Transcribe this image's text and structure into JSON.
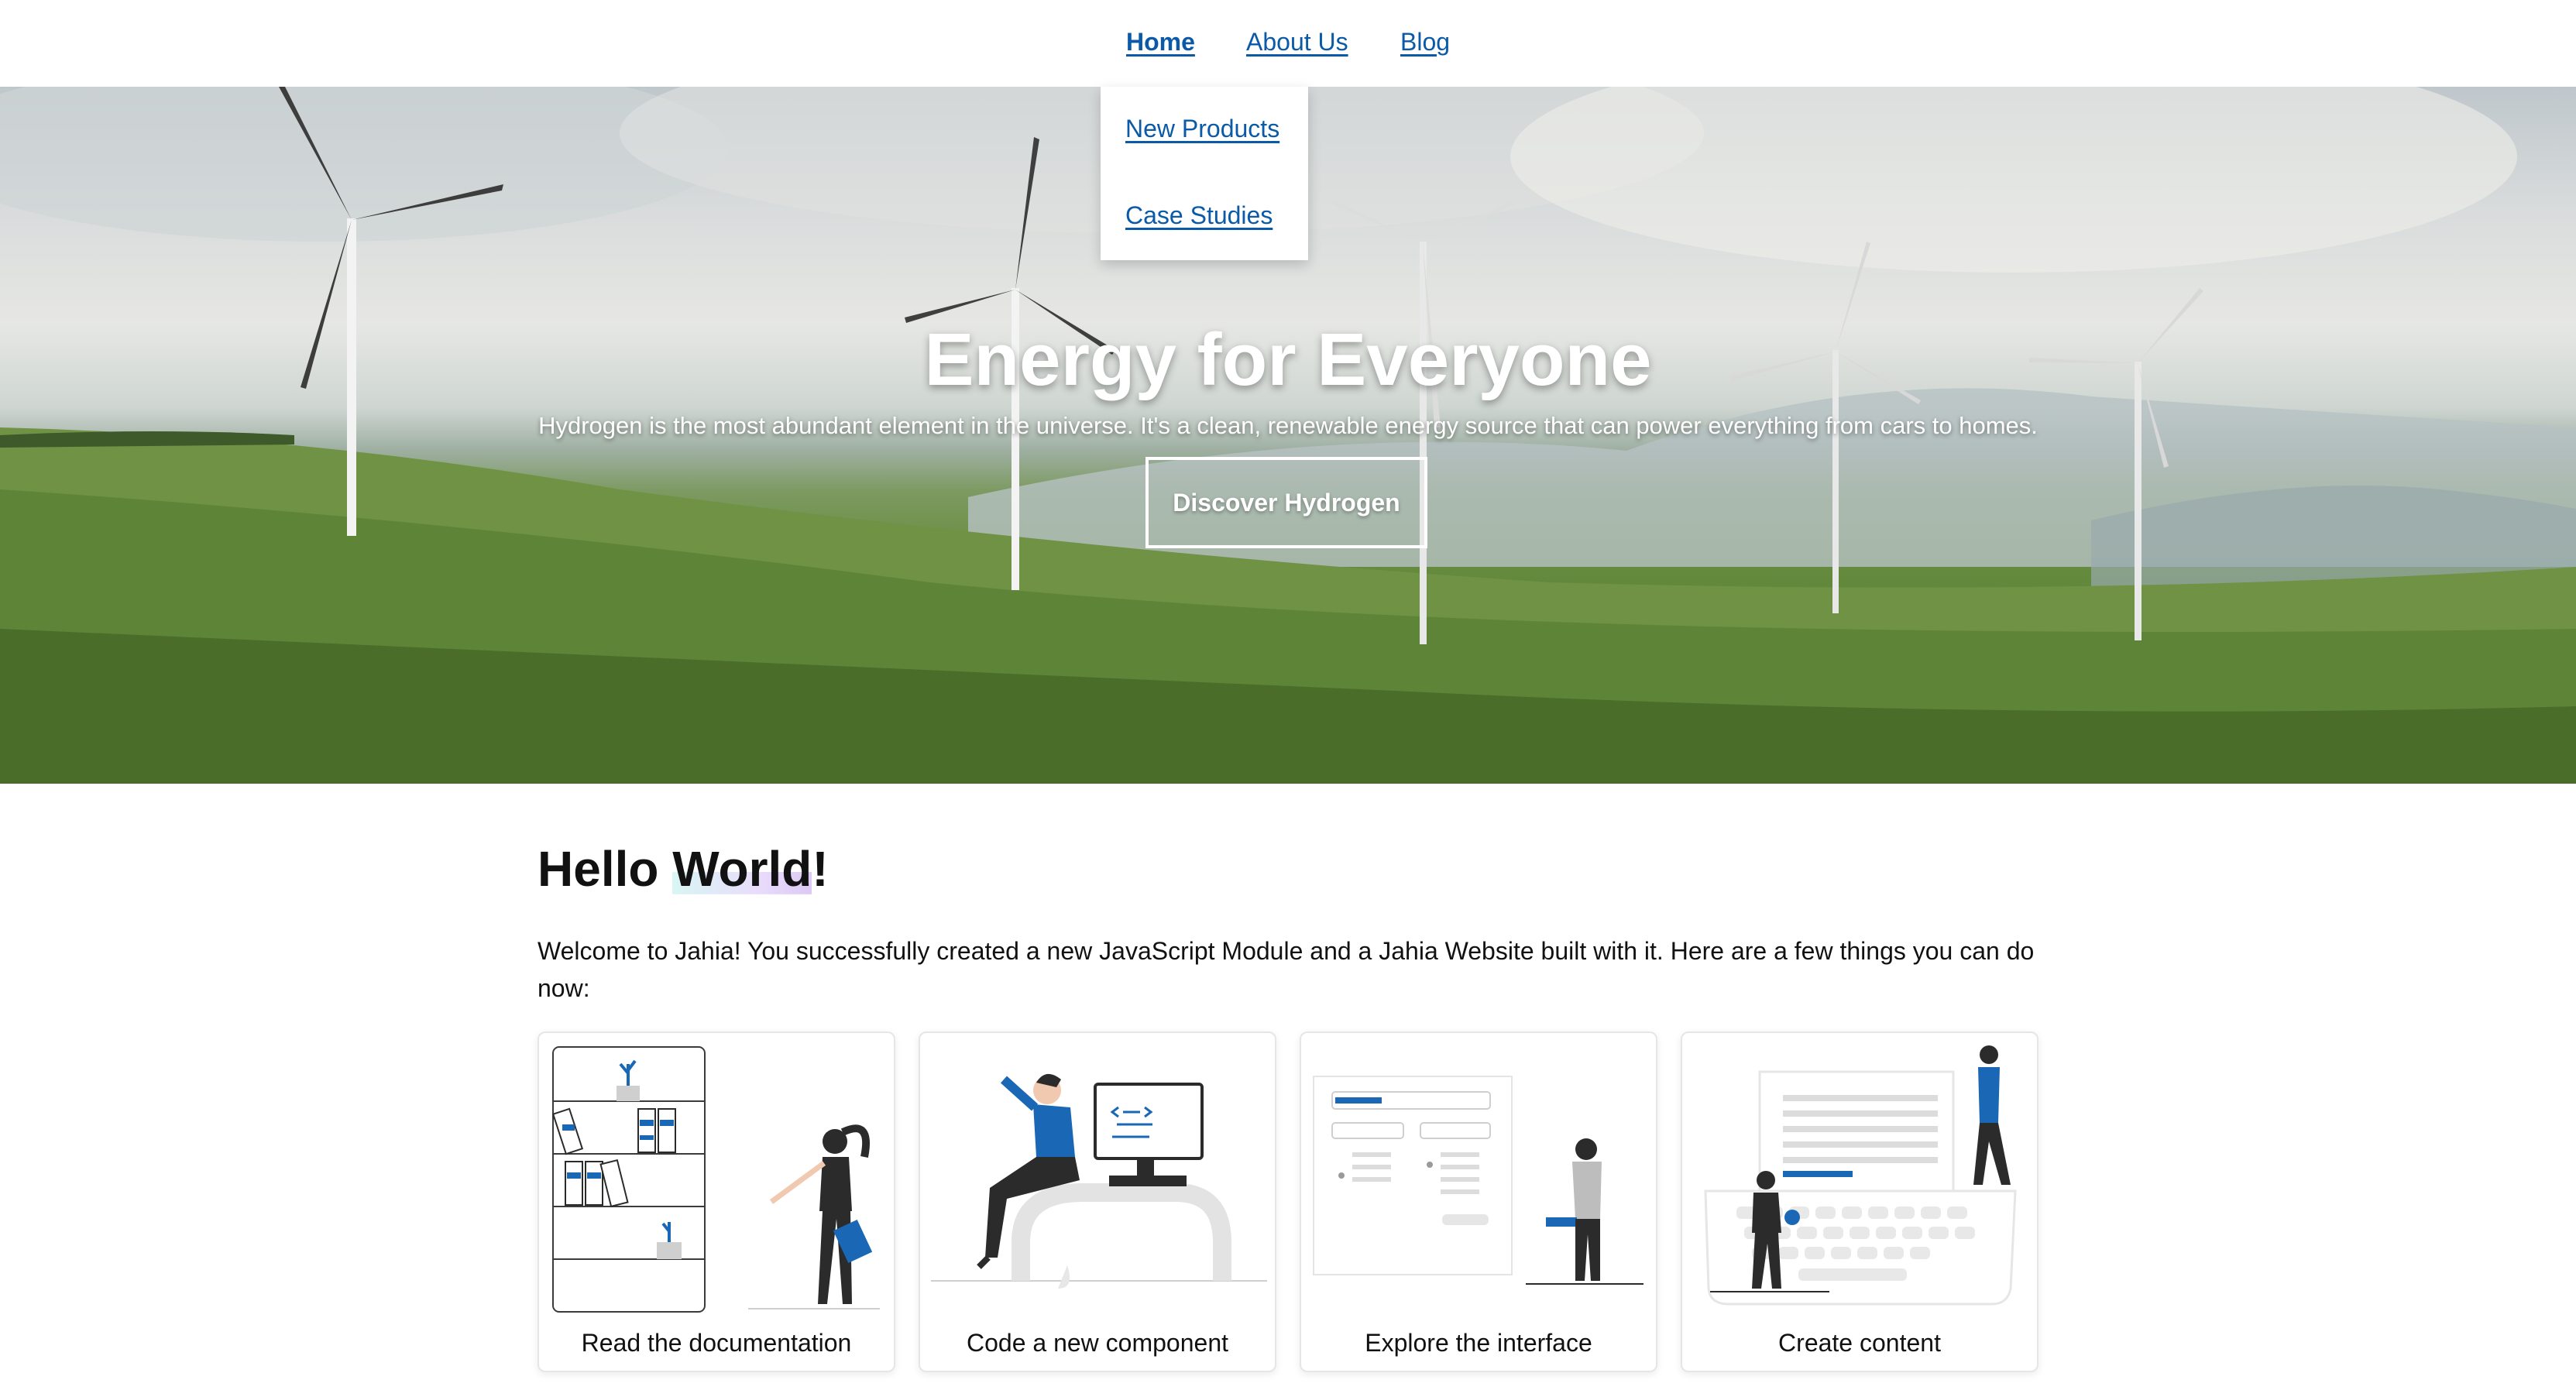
{
  "nav": {
    "items": [
      {
        "label": "Home",
        "active": true
      },
      {
        "label": "About Us"
      },
      {
        "label": "Blog"
      }
    ],
    "dropdown": [
      "New Products",
      "Case Studies"
    ]
  },
  "hero": {
    "title": "Energy for Everyone",
    "subtitle": "Hydrogen is the most abundant element in the universe. It's a clean, renewable energy source that can power everything from cars to homes.",
    "button": "Discover Hydrogen"
  },
  "content": {
    "heading_pre": "Hello ",
    "heading_highlight": "World",
    "heading_post": "!",
    "intro": "Welcome to Jahia! You successfully created a new JavaScript Module and a Jahia Website built with it. Here are a few things you can do now:"
  },
  "cards": [
    {
      "label": "Read the documentation",
      "icon": "bookshelf-illustration"
    },
    {
      "label": "Code a new component",
      "icon": "developer-illustration"
    },
    {
      "label": "Explore the interface",
      "icon": "interface-illustration"
    },
    {
      "label": "Create content",
      "icon": "content-creation-illustration"
    }
  ],
  "colors": {
    "link": "#0a5aa8",
    "accent_blue": "#1a67b5"
  }
}
